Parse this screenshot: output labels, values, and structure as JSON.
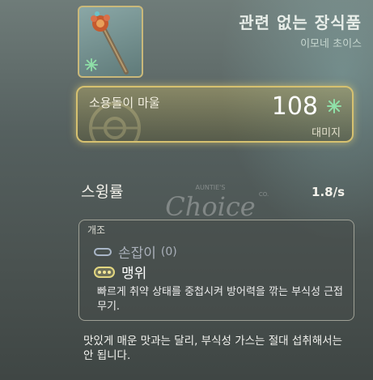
{
  "item": {
    "title": "관련 없는 장식품",
    "subtitle": "이모네 초이스"
  },
  "attack": {
    "name": "소용돌이 마울",
    "value": "108",
    "unit": "대미지",
    "icon": "damage-icon"
  },
  "swing": {
    "label": "스윙률",
    "value": "1.8/s"
  },
  "mods": {
    "header": "개조",
    "items": [
      {
        "name": "손잡이",
        "count": "(0)",
        "active": false
      },
      {
        "name": "맹위",
        "count": "",
        "active": true
      }
    ],
    "description": "빠르게 취약 상태를 중첩시켜 방어력을 깎는 부식성 근접 무기."
  },
  "flavor": "맛있게 매운 맛과는 달리, 부식성 가스는 절대 섭취해서는 안 됩니다.",
  "watermark": {
    "top": "AUNTIE'S",
    "main": "Choice",
    "suffix": "CO."
  },
  "colors": {
    "accent_gold": "#d6c170",
    "damage_icon": "#8fe0a8"
  }
}
